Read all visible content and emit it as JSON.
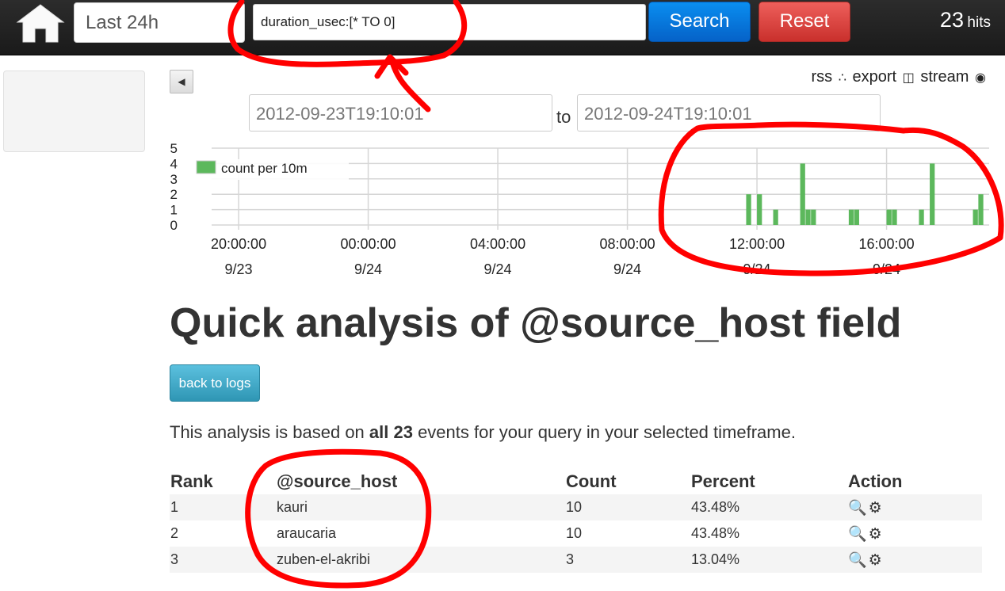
{
  "navbar": {
    "timeframe": "Last 24h",
    "query": "duration_usec:[* TO 0]",
    "search_label": "Search",
    "reset_label": "Reset",
    "hits_count": "23",
    "hits_label": "hits"
  },
  "links": {
    "rss": "rss",
    "export": "export",
    "stream": "stream"
  },
  "timerange": {
    "from": "2012-09-23T19:10:01",
    "to_label": "to",
    "to": "2012-09-24T19:10:01"
  },
  "chart_data": {
    "type": "bar",
    "legend": "count per 10m",
    "ylim": [
      0,
      5
    ],
    "yticks": [
      "0",
      "1",
      "2",
      "3",
      "4",
      "5"
    ],
    "xticks": [
      {
        "time": "20:00:00",
        "date": "9/23"
      },
      {
        "time": "00:00:00",
        "date": "9/24"
      },
      {
        "time": "04:00:00",
        "date": "9/24"
      },
      {
        "time": "08:00:00",
        "date": "9/24"
      },
      {
        "time": "12:00:00",
        "date": "9/24"
      },
      {
        "time": "16:00:00",
        "date": "9/24"
      }
    ],
    "x_start": "2012-09-23T19:10",
    "bars": [
      {
        "time": "2012-09-24T11:40",
        "value": 2
      },
      {
        "time": "2012-09-24T12:00",
        "value": 2
      },
      {
        "time": "2012-09-24T12:30",
        "value": 1
      },
      {
        "time": "2012-09-24T13:20",
        "value": 4
      },
      {
        "time": "2012-09-24T13:30",
        "value": 1
      },
      {
        "time": "2012-09-24T13:40",
        "value": 1
      },
      {
        "time": "2012-09-24T14:50",
        "value": 1
      },
      {
        "time": "2012-09-24T15:00",
        "value": 1
      },
      {
        "time": "2012-09-24T16:00",
        "value": 1
      },
      {
        "time": "2012-09-24T16:10",
        "value": 1
      },
      {
        "time": "2012-09-24T17:00",
        "value": 1
      },
      {
        "time": "2012-09-24T17:20",
        "value": 4
      },
      {
        "time": "2012-09-24T18:40",
        "value": 1
      },
      {
        "time": "2012-09-24T18:50",
        "value": 2
      }
    ]
  },
  "analysis": {
    "title": "Quick analysis of @source_host field",
    "back_label": "back to logs",
    "summary_pre": "This analysis is based on ",
    "summary_bold": "all 23",
    "summary_post": " events for your query in your selected timeframe.",
    "columns": [
      "Rank",
      "@source_host",
      "Count",
      "Percent",
      "Action"
    ],
    "rows": [
      {
        "rank": "1",
        "host": "kauri",
        "count": "10",
        "percent": "43.48%"
      },
      {
        "rank": "2",
        "host": "araucaria",
        "count": "10",
        "percent": "43.48%"
      },
      {
        "rank": "3",
        "host": "zuben-el-akribi",
        "count": "3",
        "percent": "13.04%"
      }
    ]
  },
  "colors": {
    "bar": "#5cb85c",
    "annotation": "#ff0000"
  }
}
